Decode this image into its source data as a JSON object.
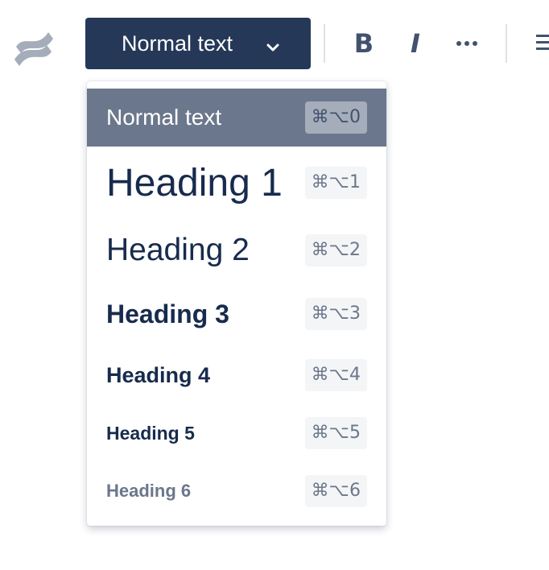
{
  "toolbar": {
    "logo_icon": "confluence-logo-icon",
    "style_dropdown": {
      "selected": "Normal text",
      "icon": "chevron-down-icon"
    },
    "bold": {
      "label": "B",
      "icon": "bold-icon"
    },
    "italic": {
      "label": "I",
      "icon": "italic-icon"
    },
    "more": {
      "icon": "more-horizontal-icon"
    },
    "list": {
      "icon": "bullet-list-icon"
    }
  },
  "menu": {
    "items": [
      {
        "label": "Normal text",
        "shortcut": "⌘⌥0",
        "selected": true
      },
      {
        "label": "Heading 1",
        "shortcut": "⌘⌥1"
      },
      {
        "label": "Heading 2",
        "shortcut": "⌘⌥2"
      },
      {
        "label": "Heading 3",
        "shortcut": "⌘⌥3"
      },
      {
        "label": "Heading 4",
        "shortcut": "⌘⌥4"
      },
      {
        "label": "Heading 5",
        "shortcut": "⌘⌥5"
      },
      {
        "label": "Heading 6",
        "shortcut": "⌘⌥6"
      }
    ]
  },
  "colors": {
    "dropdown_bg": "#253858",
    "selected_item_bg": "#6b778c",
    "text_primary": "#172b4d",
    "text_muted": "#6b778c",
    "shortcut_bg": "#f4f5f7",
    "logo_gray": "#a5adba"
  }
}
